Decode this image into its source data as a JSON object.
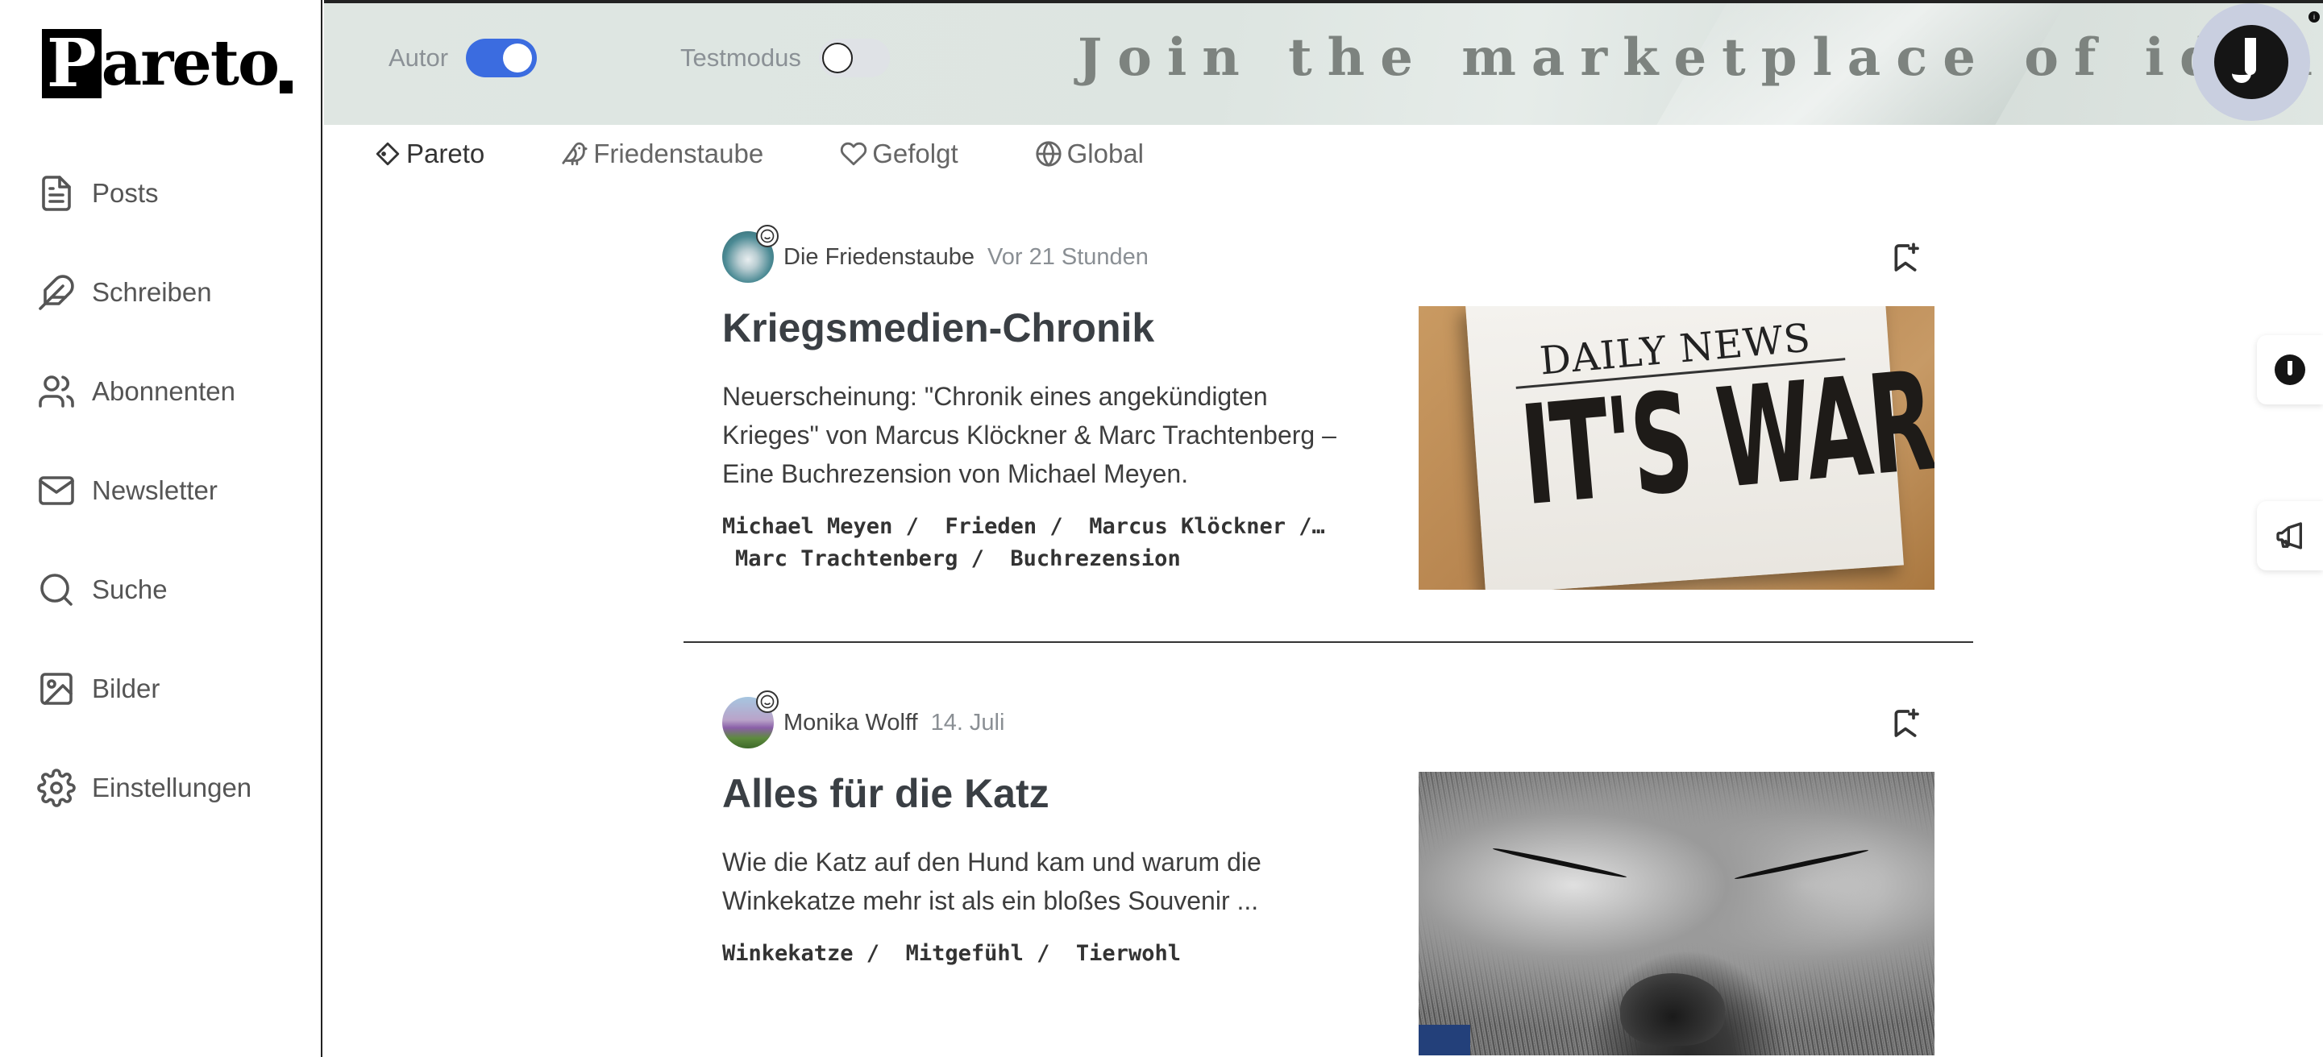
{
  "brand": {
    "logo_initial": "P",
    "logo_rest": "areto"
  },
  "sidebar": {
    "items": [
      {
        "label": "Posts",
        "icon": "document-icon"
      },
      {
        "label": "Schreiben",
        "icon": "feather-icon"
      },
      {
        "label": "Abonnenten",
        "icon": "users-icon"
      },
      {
        "label": "Newsletter",
        "icon": "mail-icon"
      },
      {
        "label": "Suche",
        "icon": "search-icon"
      },
      {
        "label": "Bilder",
        "icon": "image-icon"
      },
      {
        "label": "Einstellungen",
        "icon": "gear-icon"
      }
    ]
  },
  "header": {
    "toggles": [
      {
        "label": "Autor",
        "on": true
      },
      {
        "label": "Testmodus",
        "on": false
      }
    ],
    "tagline": "Join the marketplace of ideas",
    "colors": {
      "toggle_on": "#3b6ce0",
      "banner": "#dfe6e2"
    }
  },
  "tabs": [
    {
      "label": "Pareto",
      "icon": "tag-icon",
      "active": true
    },
    {
      "label": "Friedenstaube",
      "icon": "dove-icon",
      "active": false
    },
    {
      "label": "Gefolgt",
      "icon": "heart-icon",
      "active": false
    },
    {
      "label": "Global",
      "icon": "globe-icon",
      "active": false
    }
  ],
  "posts": [
    {
      "author": "Die Friedenstaube",
      "time": "Vor 21 Stunden",
      "title": "Kriegsmedien-Chronik",
      "excerpt": "Neuerscheinung: \"Chronik eines angekündigten Krieges\" von Marcus Klöckner & Marc Trachtenberg – Eine Buchrezension von Michael Meyen.",
      "tags_line1": [
        "Michael Meyen /",
        "Frieden /",
        "Marcus Klöckner /…"
      ],
      "tags_line2": [
        "Marc Trachtenberg /",
        "Buchrezension"
      ],
      "image": {
        "headline_small": "DAILY NEWS",
        "headline_big": "IT'S WAR!"
      }
    },
    {
      "author": "Monika Wolff",
      "time": "14. Juli",
      "title": "Alles für die Katz",
      "excerpt": "Wie die Katz auf den Hund kam und warum die Winkekatze mehr ist als ein bloßes Souvenir ...",
      "tags_line1": [
        "Winkekatze /",
        "Mitgefühl /",
        "Tierwohl"
      ],
      "tags_line2": []
    }
  ]
}
